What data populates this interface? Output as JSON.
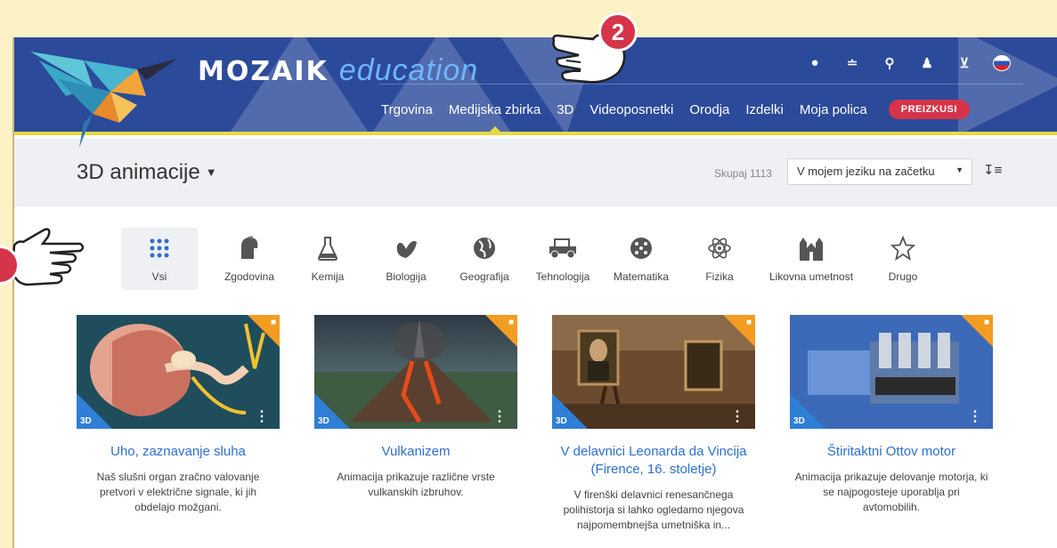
{
  "brand": {
    "name": "MOZAIK",
    "suffix": "education"
  },
  "header": {
    "top_icons": [
      "chat-icon",
      "rss-icon",
      "search-icon",
      "user-icon",
      "cart-icon",
      "language-flag-icon"
    ],
    "nav": [
      "Trgovina",
      "Medijska zbirka",
      "3D",
      "Videoposnetki",
      "Orodja",
      "Izdelki",
      "Moja polica"
    ],
    "active_nav": "Medijska zbirka",
    "try_button": "PREIZKUSI"
  },
  "titlebar": {
    "title": "3D animacije",
    "total": "Skupaj 1113",
    "sort_value": "V mojem jeziku na začetku"
  },
  "categories": [
    {
      "label": "Vsi",
      "icon": "grid-icon",
      "active": true
    },
    {
      "label": "Zgodovina",
      "icon": "helmet-icon"
    },
    {
      "label": "Kemija",
      "icon": "flask-icon"
    },
    {
      "label": "Biologija",
      "icon": "butterfly-icon"
    },
    {
      "label": "Geografija",
      "icon": "globe-icon"
    },
    {
      "label": "Tehnologija",
      "icon": "car-icon"
    },
    {
      "label": "Matematika",
      "icon": "dice-icon"
    },
    {
      "label": "Fizika",
      "icon": "atom-icon"
    },
    {
      "label": "Likovna umetnost",
      "icon": "cathedral-icon"
    },
    {
      "label": "Drugo",
      "icon": "star-icon"
    }
  ],
  "cards": [
    {
      "badge": "3D",
      "title": "Uho, zaznavanje sluha",
      "desc": "Naš slušni organ zračno valovanje pretvori v električne signale, ki jih obdelajo možgani."
    },
    {
      "badge": "3D",
      "title": "Vulkanizem",
      "desc": "Animacija prikazuje različne vrste vulkanskih izbruhov."
    },
    {
      "badge": "3D",
      "title": "V delavnici Leonarda da Vincija (Firence, 16. stoletje)",
      "desc": "V firenški delavnici renesančnega polihistorja si lahko ogledamo njegova najpomembnejša umetniška in..."
    },
    {
      "badge": "3D",
      "title": "Štiritaktni Ottov motor",
      "desc": "Animacija prikazuje delovanje motorja, ki se najpogosteje uporablja pri avtomobilih."
    }
  ],
  "callouts": {
    "step": "2"
  },
  "colors": {
    "header_bg": "#2b4a9a",
    "accent_yellow": "#e9d93e",
    "link_blue": "#2d6fd0",
    "try_red": "#d6344a",
    "badge_orange": "#f29c22"
  }
}
